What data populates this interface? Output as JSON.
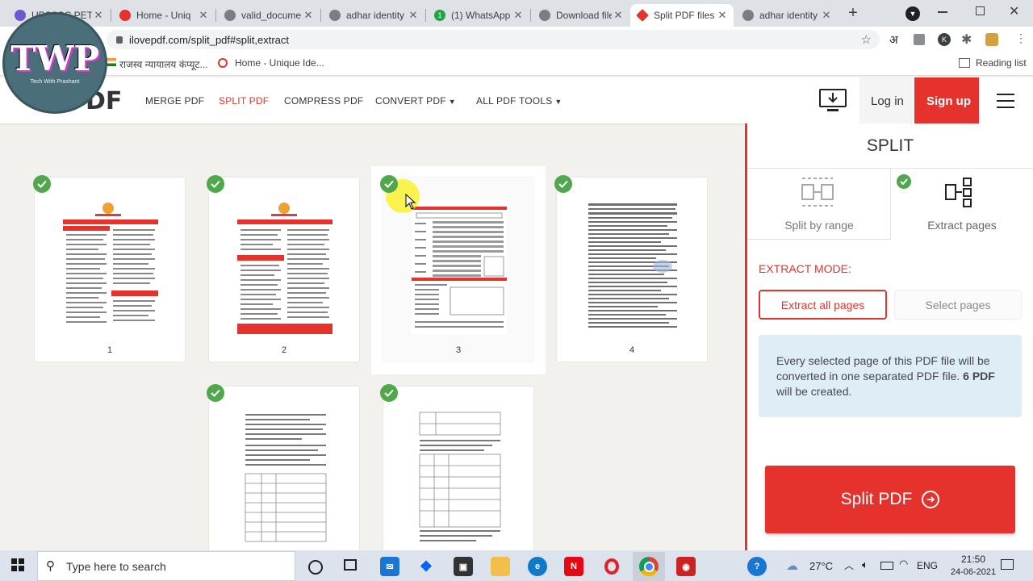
{
  "browser": {
    "tabs": [
      {
        "title": "UPSSSC PET O"
      },
      {
        "title": "Home - Uniq"
      },
      {
        "title": "valid_docume"
      },
      {
        "title": "adhar identity"
      },
      {
        "title": "(1) WhatsApp"
      },
      {
        "title": "Download file"
      },
      {
        "title": "Split PDF files"
      },
      {
        "title": "adhar identity"
      }
    ],
    "url": "ilovepdf.com/split_pdf#split,extract",
    "bookmarks": [
      "राजस्व न्यायालय कंप्यूट...",
      "Home - Unique Ide..."
    ],
    "reading_list": "Reading list",
    "toolbar_lang": "अ",
    "avatar_letter": "K"
  },
  "watermark": {
    "text": "TWP",
    "sub": "Tech With Prashant"
  },
  "site": {
    "logo_text": "PDF",
    "nav": [
      "MERGE PDF",
      "SPLIT PDF",
      "COMPRESS PDF",
      "CONVERT PDF",
      "ALL PDF TOOLS"
    ],
    "login": "Log in",
    "signup": "Sign up"
  },
  "pages": [
    {
      "label": "1"
    },
    {
      "label": "2"
    },
    {
      "label": "3"
    },
    {
      "label": "4"
    },
    {
      "label": ""
    },
    {
      "label": ""
    }
  ],
  "panel": {
    "title": "SPLIT",
    "mode_range": "Split by range",
    "mode_extract": "Extract pages",
    "extract_mode_label": "EXTRACT MODE:",
    "btn_all": "Extract all pages",
    "btn_select": "Select pages",
    "info_text": "Every selected page of this PDF file will be converted in one separated PDF file.",
    "info_count": "6 PDF",
    "info_suffix": " will be created.",
    "split_button": "Split PDF"
  },
  "taskbar": {
    "search_placeholder": "Type here to search",
    "temperature": "27°C",
    "lang": "ENG",
    "time": "21:50",
    "date": "24-06-2021"
  },
  "colors": {
    "brand_red": "#e5322d",
    "check_green": "#4fa84b",
    "info_bg": "#dfeef6"
  }
}
